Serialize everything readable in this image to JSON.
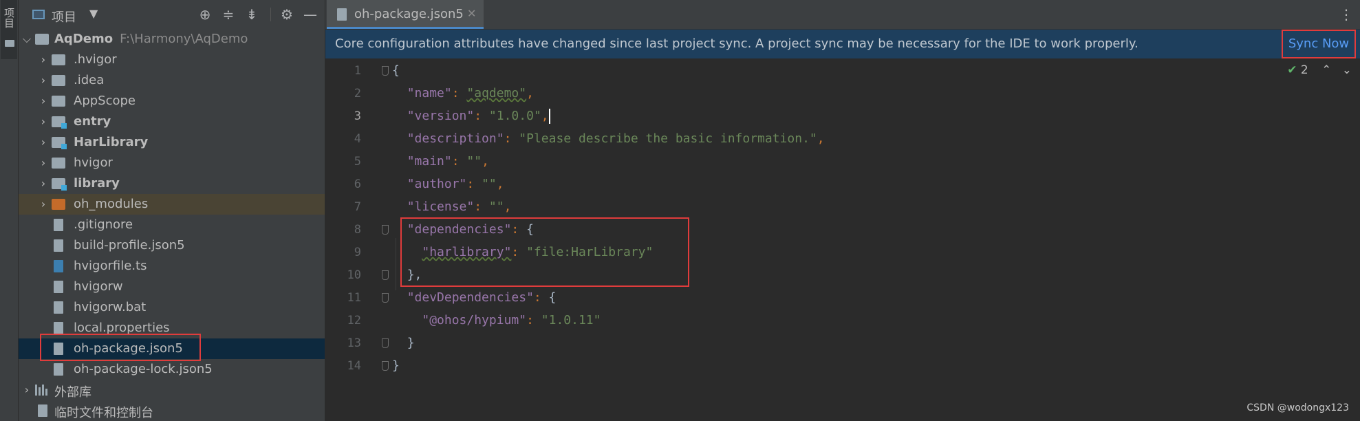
{
  "stripe": {
    "label": "项目"
  },
  "project_panel": {
    "title": "项目",
    "tree": [
      {
        "label": "AqDemo",
        "path": "F:\\Harmony\\AqDemo"
      },
      {
        "label": ".hvigor"
      },
      {
        "label": ".idea"
      },
      {
        "label": "AppScope"
      },
      {
        "label": "entry"
      },
      {
        "label": "HarLibrary"
      },
      {
        "label": "hvigor"
      },
      {
        "label": "library"
      },
      {
        "label": "oh_modules"
      },
      {
        "label": ".gitignore"
      },
      {
        "label": "build-profile.json5"
      },
      {
        "label": "hvigorfile.ts"
      },
      {
        "label": "hvigorw"
      },
      {
        "label": "hvigorw.bat"
      },
      {
        "label": "local.properties"
      },
      {
        "label": "oh-package.json5"
      },
      {
        "label": "oh-package-lock.json5"
      },
      {
        "label": "外部库"
      },
      {
        "label": "临时文件和控制台"
      }
    ]
  },
  "editor": {
    "tab_label": "oh-package.json5",
    "tab_close": "✕",
    "banner_text": "Core configuration attributes have changed since last project sync. A project sync may be necessary for the IDE to work properly.",
    "sync_button": "Sync Now",
    "inspection_count": "2",
    "current_line": "3",
    "line_numbers": [
      "1",
      "2",
      "3",
      "4",
      "5",
      "6",
      "7",
      "8",
      "9",
      "10",
      "11",
      "12",
      "13",
      "14"
    ],
    "code": {
      "l1": "{",
      "name_key": "\"name\"",
      "name_val": "\"aqdemo\"",
      "version_key": "\"version\"",
      "version_val": "\"1.0.0\"",
      "description_key": "\"description\"",
      "description_val": "\"Please describe the basic information.\"",
      "main_key": "\"main\"",
      "main_val": "\"\"",
      "author_key": "\"author\"",
      "author_val": "\"\"",
      "license_key": "\"license\"",
      "license_val": "\"\"",
      "deps_key": "\"dependencies\"",
      "harlib_key": "\"harlibrary\"",
      "harlib_val": "\"file:HarLibrary\"",
      "devdeps_key": "\"devDependencies\"",
      "hypium_key": "\"@ohos/hypium\"",
      "hypium_val": "\"1.0.11\"",
      "close_obj_comma": "},",
      "close_obj": "}",
      "close_root": "}"
    }
  },
  "watermark": "CSDN @wodongx123",
  "colors": {
    "annotation_red": "#e03c3c",
    "selection": "#0d293e",
    "banner": "#1e3f5d",
    "link_blue": "#589df6"
  }
}
